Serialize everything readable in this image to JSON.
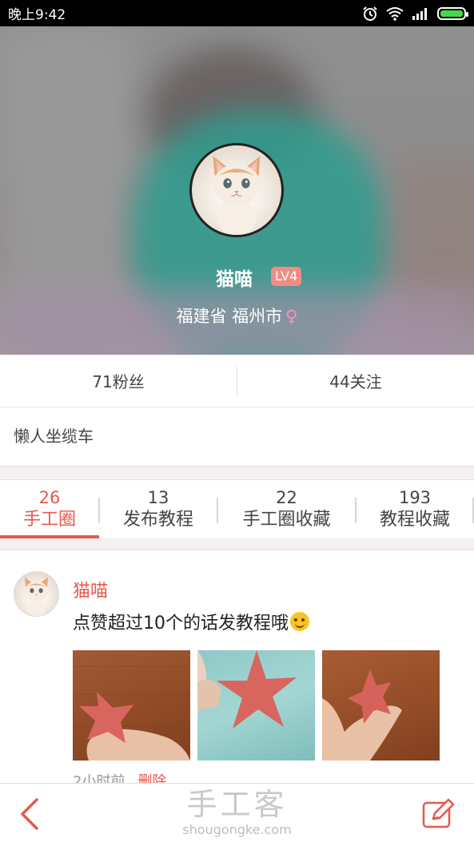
{
  "status_bar": {
    "time": "晚上9:42"
  },
  "profile": {
    "name": "猫喵",
    "level": "LV4",
    "location": "福建省 福州市",
    "gender_icon": "♀"
  },
  "stats": {
    "fans": "71粉丝",
    "following": "44关注"
  },
  "bio": "懒人坐缆车",
  "tabs": [
    {
      "count": "26",
      "label": "手工圈",
      "active": true
    },
    {
      "count": "13",
      "label": "发布教程",
      "active": false
    },
    {
      "count": "22",
      "label": "手工圈收藏",
      "active": false
    },
    {
      "count": "193",
      "label": "教程收藏",
      "active": false
    }
  ],
  "post": {
    "author": "猫喵",
    "text": "点赞超过10个的话发教程哦",
    "time": "2小时前",
    "delete_label": "删除",
    "images": [
      "paper-star-hand-1",
      "paper-star-hand-2",
      "paper-star-hand-3"
    ]
  },
  "bottom_bar": {
    "watermark_cn": "手工客",
    "watermark_en": "shougongke.com"
  },
  "colors": {
    "accent": "#e8584b",
    "badge": "#f08c84",
    "gender": "#ff93b8"
  }
}
